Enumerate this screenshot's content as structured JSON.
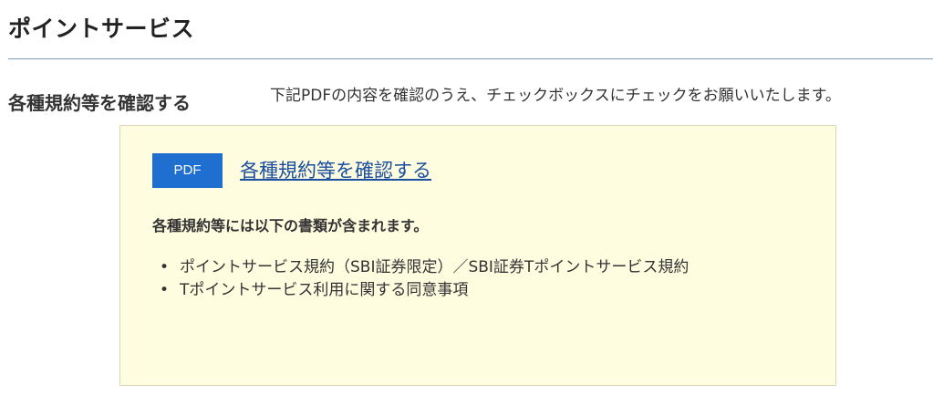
{
  "section": {
    "title": "ポイントサービス"
  },
  "terms_row": {
    "label": "各種規約等を確認する",
    "instruction": "下記PDFの内容を確認のうえ、チェックボックスにチェックをお願いいたします。"
  },
  "doc_box": {
    "badge": "PDF",
    "link_text": "各種規約等を確認する",
    "includes_title": "各種規約等には以下の書類が含まれます。",
    "items": [
      "ポイントサービス規約（SBI証券限定）／SBI証券Tポイントサービス規約",
      "Tポイントサービス利用に関する同意事項"
    ]
  },
  "colors": {
    "badge_bg": "#1f6fd0",
    "box_bg": "#fffde0",
    "link": "#1a4fa0",
    "divider": "#7d9cb8"
  }
}
